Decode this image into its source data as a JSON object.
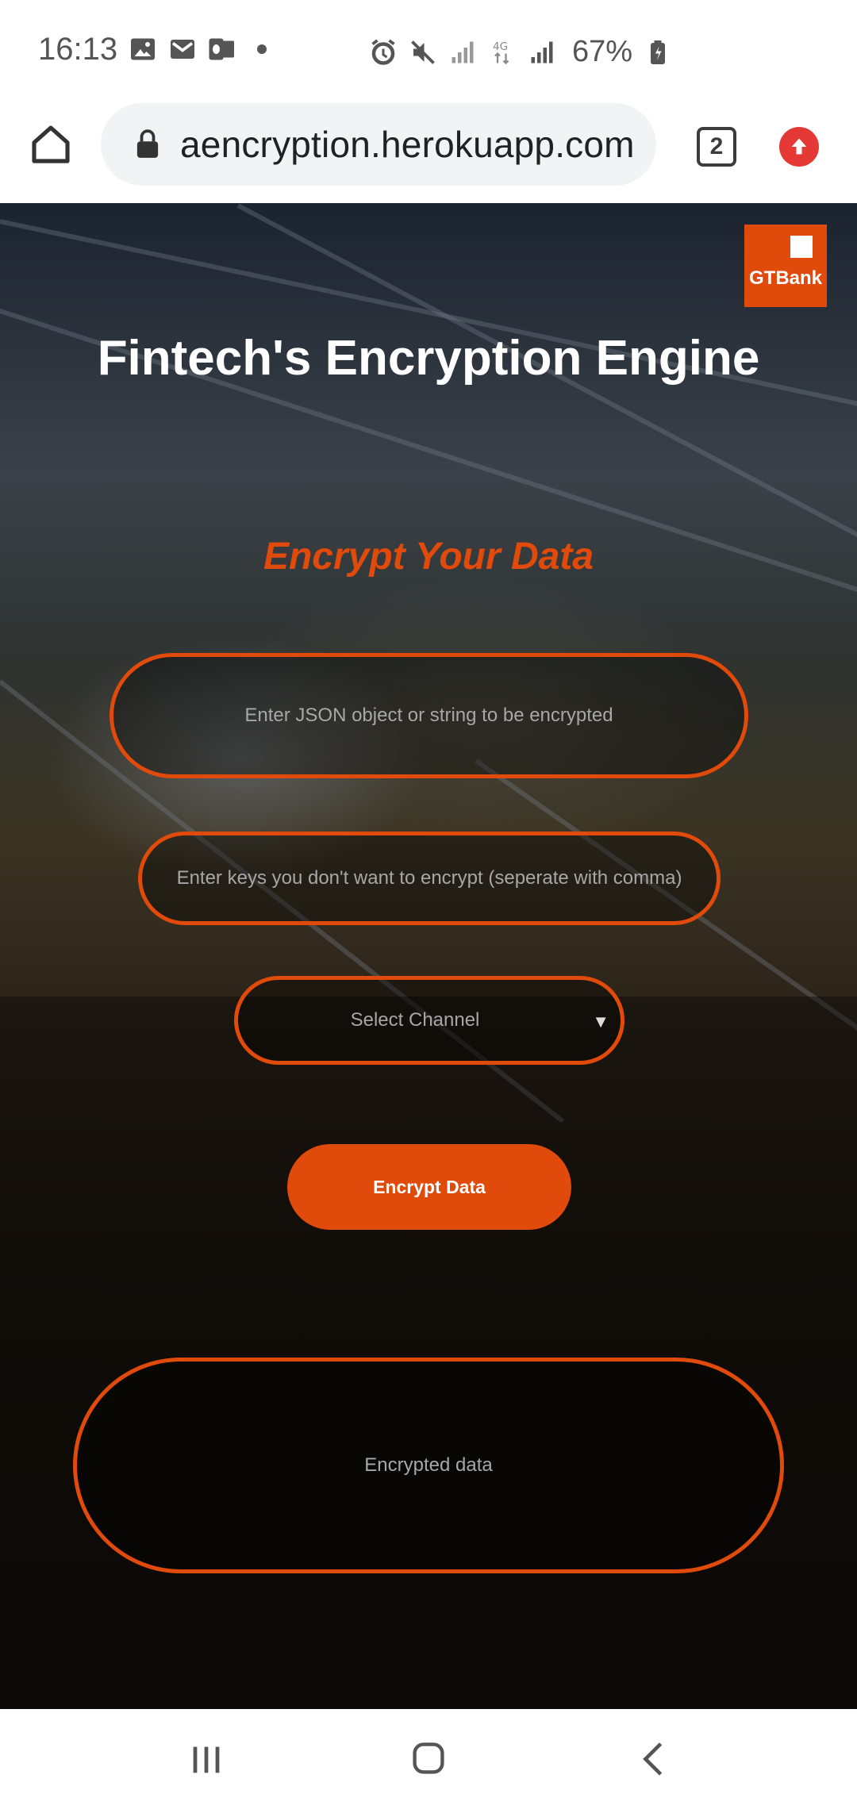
{
  "status_bar": {
    "time": "16:13",
    "left_icons": [
      "gallery-icon",
      "gmail-icon",
      "outlook-icon",
      "dot-icon"
    ],
    "right_icons": [
      "alarm-icon",
      "mute-icon",
      "signal-icon",
      "4g-data-icon",
      "signal-icon",
      "battery-icon"
    ],
    "battery_percent": "67%"
  },
  "browser": {
    "url": "aencryption.herokuapp.com",
    "tab_count": "2"
  },
  "page": {
    "logo_text": "GTBank",
    "title": "Fintech's Encryption Engine",
    "section_title": "Encrypt Your Data",
    "json_input_placeholder": "Enter JSON object or string to be encrypted",
    "keys_input_placeholder": "Enter keys you don't want to encrypt (seperate with comma)",
    "channel_select_label": "Select Channel",
    "encrypt_button_label": "Encrypt Data",
    "output_placeholder": "Encrypted data"
  },
  "colors": {
    "accent": "#e04a0b",
    "text_light": "#ffffff",
    "placeholder": "#a7a7a7"
  }
}
